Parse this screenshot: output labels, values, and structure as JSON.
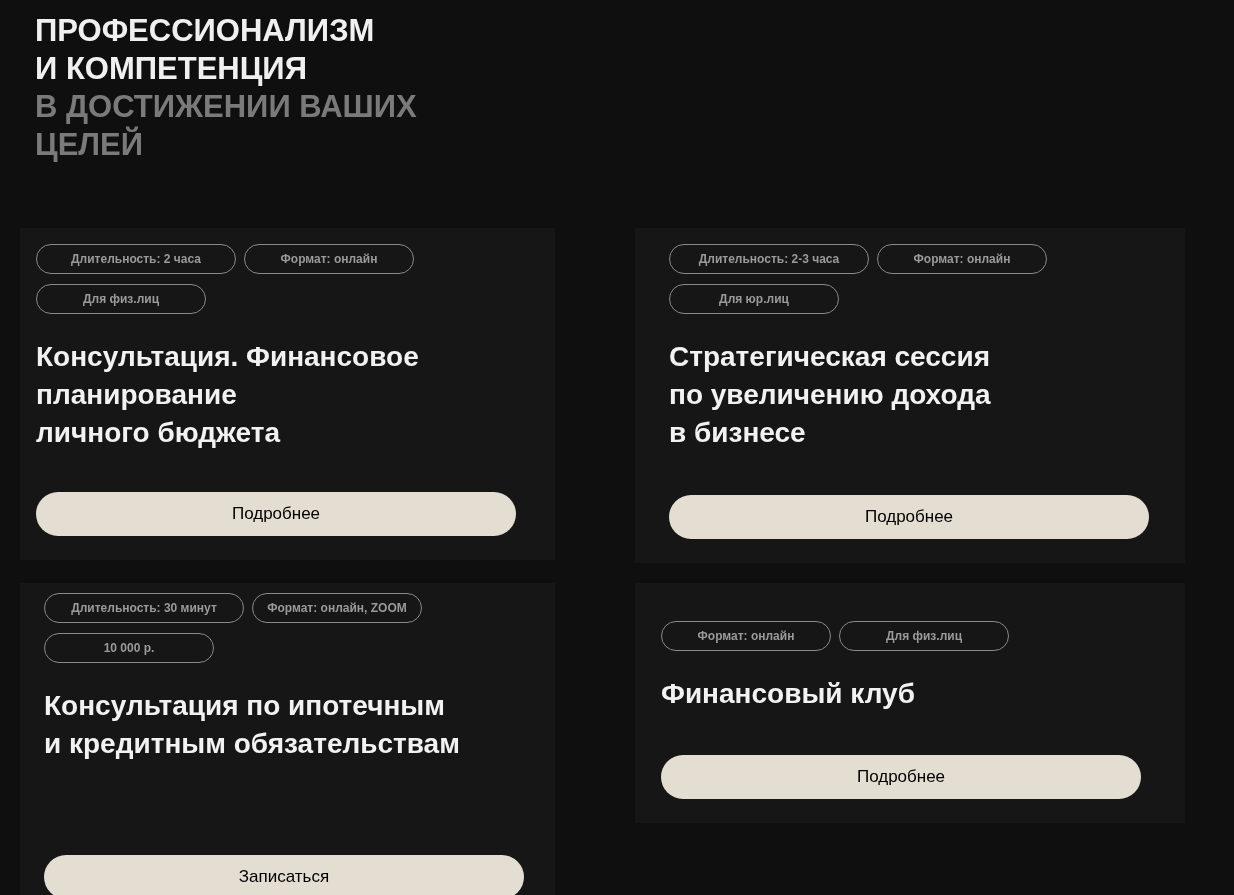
{
  "heading": {
    "lines": [
      {
        "text": "ПРОФЕССИОНАЛИЗМ",
        "muted": false
      },
      {
        "text": "И КОМПЕТЕНЦИЯ",
        "muted": false
      },
      {
        "text": "В ДОСТИЖЕНИИ ВАШИХ",
        "muted": true
      },
      {
        "text": "ЦЕЛЕЙ",
        "muted": true
      }
    ]
  },
  "cards": [
    {
      "tags": [
        "Длительность: 2 часа",
        "Формат: онлайн",
        "Для физ.лиц"
      ],
      "title_lines": [
        "Консультация. Финансовое",
        "планирование",
        "личного бюджета"
      ],
      "button": "Подробнее"
    },
    {
      "tags": [
        "Длительность: 2-3 часа",
        "Формат: онлайн",
        "Для юр.лиц"
      ],
      "title_lines": [
        "Стратегическая сессия",
        "по увеличению дохода",
        "в бизнесе"
      ],
      "button": "Подробнее"
    },
    {
      "tags": [
        "Длительность: 30 минут",
        "Формат: онлайн, ZOOM",
        "10 000 р."
      ],
      "title_lines": [
        "Консультация по ипотечным",
        "и кредитным обязательствам"
      ],
      "button": "Записаться"
    },
    {
      "tags": [
        "Формат: онлайн",
        "Для физ.лиц"
      ],
      "title_lines": [
        "Финансовый клуб"
      ],
      "button": "Подробнее"
    }
  ]
}
